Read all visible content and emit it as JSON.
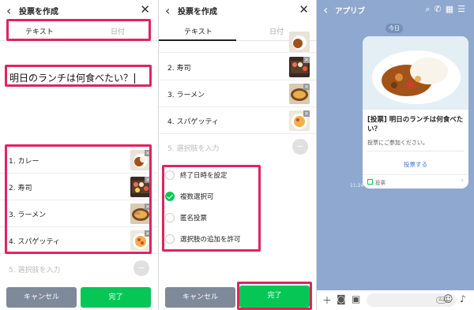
{
  "panel1": {
    "title": "投票を作成",
    "back_icon": "‹",
    "close_icon": "✕",
    "tabs": [
      {
        "label": "テキスト"
      },
      {
        "label": "日付"
      }
    ],
    "question": "明日のランチは何食べたい？",
    "options": [
      {
        "label": "1.  カレー"
      },
      {
        "label": "2.  寿司"
      },
      {
        "label": "3.  ラーメン"
      },
      {
        "label": "4.  スパゲッティ"
      }
    ],
    "add_placeholder": "5.  選択肢を入力",
    "cancel_label": "キャンセル",
    "done_label": "完了"
  },
  "panel2": {
    "title": "投票を作成",
    "tabs": [
      {
        "label": "テキスト"
      },
      {
        "label": "日付"
      }
    ],
    "options": [
      {
        "label": "2.  寿司"
      },
      {
        "label": "3.  ラーメン"
      },
      {
        "label": "4.  スパゲッティ"
      }
    ],
    "add_placeholder": "5.  選択肢を入力",
    "settings": [
      {
        "label": "終了日時を設定",
        "checked": false
      },
      {
        "label": "複数選択可",
        "checked": true
      },
      {
        "label": "匿名投票",
        "checked": false
      },
      {
        "label": "選択肢の追加を許可",
        "checked": false
      }
    ],
    "cancel_label": "キャンセル",
    "done_label": "完了"
  },
  "panel3": {
    "chat_name": "アプリブ",
    "date_label": "今日",
    "card_title": "[投票] 明日のランチは何食べたい？",
    "card_subtitle": "投票にご参加ください。",
    "card_link": "投票する",
    "card_footer": "投票",
    "timestamp": "11:24",
    "header_icons": [
      "search-icon",
      "phone-icon",
      "calendar-icon",
      "menu-icon"
    ]
  },
  "colors": {
    "accent_green": "#06c755",
    "highlight": "#e0245e",
    "chat_bg": "#8fa8cf",
    "cancel_gray": "#7e8a99"
  }
}
